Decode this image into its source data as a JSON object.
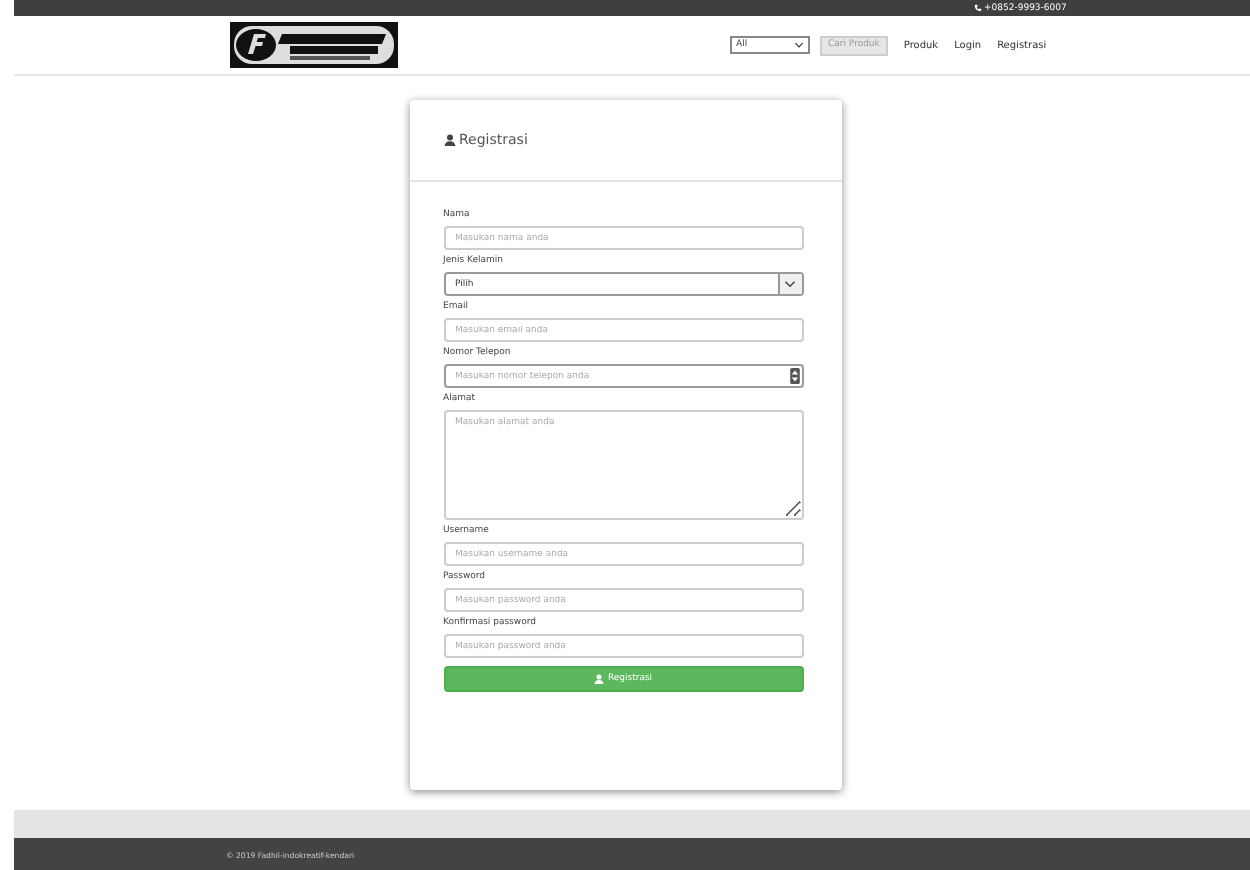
{
  "top_bar": {
    "phone": "+0852-9993-6007"
  },
  "header": {
    "category_select": {
      "value": "All"
    },
    "search_button": "Cari Produk",
    "nav": [
      {
        "label": "Produk"
      },
      {
        "label": "Login"
      },
      {
        "label": "Registrasi"
      }
    ]
  },
  "card": {
    "title": "Registrasi",
    "fields": [
      {
        "kind": "input",
        "label": "Nama",
        "placeholder": "Masukan nama anda"
      },
      {
        "kind": "select",
        "label": "Jenis Kelamin",
        "value": "Pilih"
      },
      {
        "kind": "input",
        "label": "Email",
        "placeholder": "Masukan email anda"
      },
      {
        "kind": "number",
        "label": "Nomor Telepon",
        "placeholder": "Masukan nomor telepon anda"
      },
      {
        "kind": "textarea",
        "label": "Alamat",
        "placeholder": "Masukan alamat anda"
      },
      {
        "kind": "input",
        "label": "Username",
        "placeholder": "Masukan username anda"
      },
      {
        "kind": "input",
        "label": "Password",
        "placeholder": "Masukan password anda"
      },
      {
        "kind": "input",
        "label": "Konfirmasi password",
        "placeholder": "Masukan password anda"
      }
    ],
    "submit": "Registrasi"
  },
  "footer": {
    "copyright": "© 2019 Fadhil-indokreatif-kendari"
  }
}
